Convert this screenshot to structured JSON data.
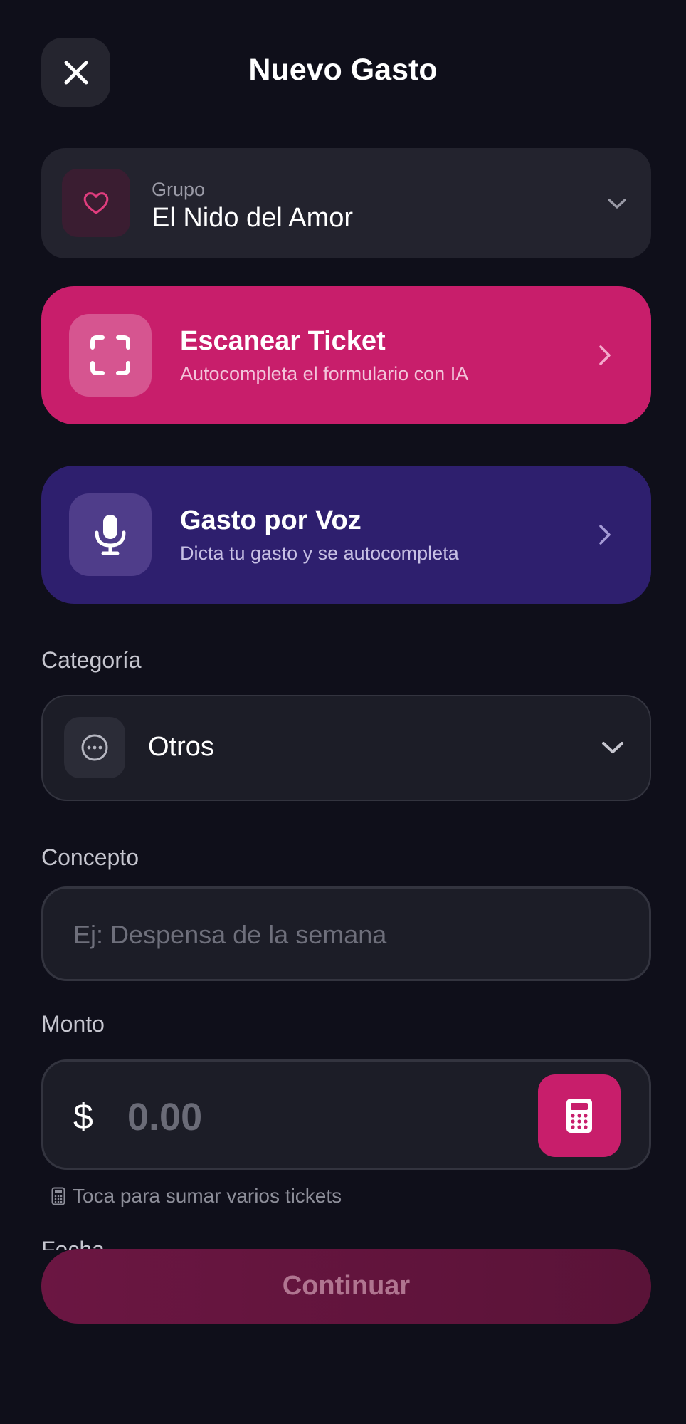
{
  "header": {
    "title": "Nuevo Gasto"
  },
  "group": {
    "label": "Grupo",
    "name": "El Nido del Amor"
  },
  "actions": {
    "scan": {
      "title": "Escanear Ticket",
      "subtitle": "Autocompleta el formulario con IA"
    },
    "voice": {
      "title": "Gasto por Voz",
      "subtitle": "Dicta tu gasto y se autocompleta"
    }
  },
  "category": {
    "label": "Categoría",
    "value": "Otros"
  },
  "concept": {
    "label": "Concepto",
    "placeholder": "Ej: Despensa de la semana"
  },
  "amount": {
    "label": "Monto",
    "currency": "$",
    "placeholder": "0.00",
    "hint": "Toca para sumar varios tickets"
  },
  "date": {
    "label": "Fecha"
  },
  "footer": {
    "continue_label": "Continuar"
  },
  "colors": {
    "accent": "#c81e6b",
    "voice": "#2e1f6e",
    "background": "#0f0f1a"
  }
}
